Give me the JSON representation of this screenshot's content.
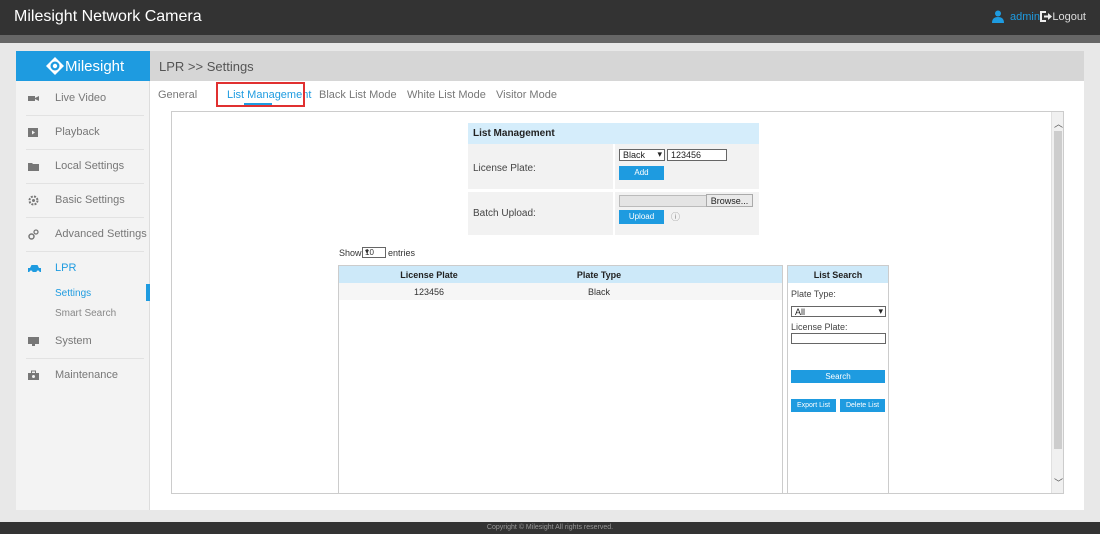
{
  "topbar": {
    "title": "Milesight Network Camera",
    "user": "admin",
    "logout": "Logout"
  },
  "sidebar": {
    "logo": "Milesight",
    "items": [
      {
        "label": "Live Video",
        "icon": "video-icon"
      },
      {
        "label": "Playback",
        "icon": "playback-icon"
      },
      {
        "label": "Local Settings",
        "icon": "folder-icon"
      },
      {
        "label": "Basic Settings",
        "icon": "gear-icon"
      },
      {
        "label": "Advanced Settings",
        "icon": "gears-icon"
      },
      {
        "label": "LPR",
        "icon": "car-icon"
      },
      {
        "label": "System",
        "icon": "monitor-icon"
      },
      {
        "label": "Maintenance",
        "icon": "toolbox-icon"
      }
    ],
    "lpr_sub": [
      "Settings",
      "Smart Search"
    ]
  },
  "main": {
    "breadcrumb": "LPR >> Settings",
    "tabs": [
      "General",
      "List Management",
      "Black List Mode",
      "White List Mode",
      "Visitor Mode"
    ],
    "active_tab": "List Management"
  },
  "list_management": {
    "title": "List Management",
    "license_plate_label": "License Plate:",
    "plate_type_value": "Black",
    "plate_value": "123456",
    "add_label": "Add",
    "batch_upload_label": "Batch Upload:",
    "browse_label": "Browse...",
    "upload_label": "Upload"
  },
  "table": {
    "show_label": "Show",
    "entries_value": "10",
    "entries_label": "entries",
    "columns": [
      "License Plate",
      "Plate Type"
    ],
    "rows": [
      [
        "123456",
        "Black"
      ]
    ]
  },
  "list_search": {
    "title": "List Search",
    "plate_type_label": "Plate Type:",
    "plate_type_value": "All",
    "license_plate_label": "License Plate:",
    "search_label": "Search",
    "export_label": "Export List",
    "delete_label": "Delete List"
  },
  "footer": "Copyright © Milesight All rights reserved.",
  "colors": {
    "accent": "#1e9be0",
    "topbar": "#333333",
    "highlight_box": "#e03030"
  }
}
